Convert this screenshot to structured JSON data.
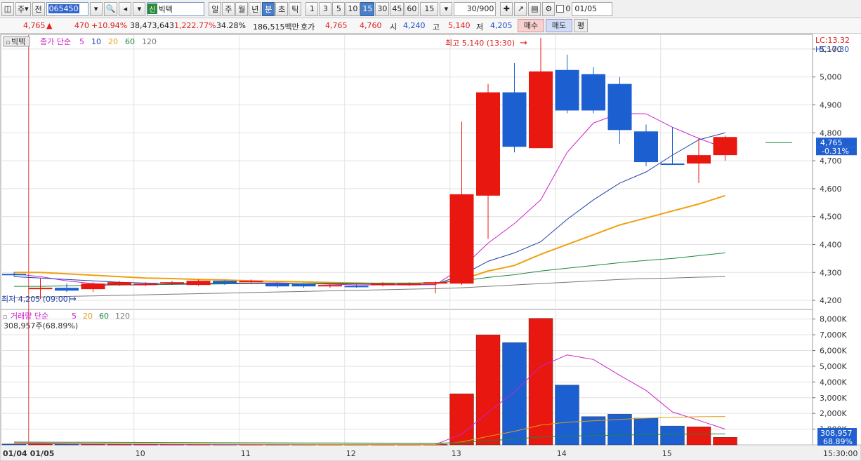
{
  "toolbar": {
    "period_unit_label": "주",
    "market_label": "전",
    "stock_code": "065450",
    "stock_tag": "신",
    "stock_name": "빅텍",
    "periods": [
      "일",
      "주",
      "월",
      "년",
      "분",
      "초",
      "틱"
    ],
    "selected_period": "분",
    "intervals": [
      "1",
      "3",
      "5",
      "10",
      "15",
      "30",
      "45",
      "60"
    ],
    "selected_interval": "15",
    "interval_value": "15",
    "count": "30/900",
    "date": "01/05",
    "checkbox_label": "0"
  },
  "info": {
    "price": "4,765",
    "change_arrow": "▲",
    "change": "470",
    "change_pct": "+10.94%",
    "volume": "38,473,643",
    "volume_pct": "1,222.77%",
    "turnover": "34.28%",
    "amount": "186,515백만",
    "ask_label": "호가",
    "ask": "4,765",
    "bid": "4,760",
    "open_label": "시",
    "open": "4,240",
    "high_label": "고",
    "high": "5,140",
    "low_label": "저",
    "low": "4,205",
    "buy_label": "매수",
    "sell_label": "매도",
    "avg_label": "평"
  },
  "price_panel": {
    "name_tag": "빅텍",
    "legend_prefix": "종가 단순",
    "ma_periods": [
      "5",
      "10",
      "20",
      "60",
      "120"
    ],
    "ma_colors": [
      "#cc22cc",
      "#1f3fa8",
      "#f0a010",
      "#1a8a3a",
      "#777777"
    ],
    "lc_label": "LC:13.32",
    "hc_label": "HC:-7.30",
    "high_annotation": "최고 5,140 (13:30)",
    "low_annotation": "최저 4,205 (09:00)",
    "current_price_label": "4,765",
    "current_pct_label": "-0.31%"
  },
  "volume_panel": {
    "legend_prefix": "거래량 단순",
    "ma_periods": [
      "5",
      "20",
      "60",
      "120"
    ],
    "ma_colors": [
      "#cc22cc",
      "#e0a010",
      "#1a8a3a",
      "#777777"
    ],
    "current_volume_label": "308,957주(68.89%)",
    "current_value_label": "308,957",
    "current_pct_label": "68.89%"
  },
  "x_axis": {
    "date_left": "01/04",
    "date_right": "01/05",
    "hour_labels": [
      "10",
      "11",
      "12",
      "13",
      "14",
      "15"
    ],
    "end_time": "15:30:00"
  },
  "colors": {
    "up": "#e8170f",
    "down": "#1b5fd0",
    "grid": "#e2e2e2"
  },
  "chart_data": [
    {
      "type": "candlestick",
      "title": "",
      "ylim": [
        4170,
        5150
      ],
      "y_ticks": [
        4200,
        4300,
        4400,
        4500,
        4600,
        4700,
        4800,
        4900,
        5000,
        5100
      ],
      "y_tick_labels": [
        "4,200",
        "4,300",
        "4,400",
        "4,500",
        "4,600",
        "4,700",
        "4,800",
        "4,900",
        "5,000",
        "5,100"
      ],
      "x": [
        "01/04 15:15",
        "09:00",
        "09:15",
        "09:30",
        "09:45",
        "10:00",
        "10:15",
        "10:30",
        "10:45",
        "11:00",
        "11:15",
        "11:30",
        "11:45",
        "12:00",
        "12:15",
        "12:30",
        "12:45",
        "13:00",
        "13:15",
        "13:30",
        "13:45",
        "14:00",
        "14:15",
        "14:30",
        "14:45",
        "15:00",
        "15:15",
        "15:30"
      ],
      "open": [
        4295,
        4240,
        4245,
        4240,
        4255,
        4255,
        4260,
        4255,
        4270,
        4265,
        4260,
        4258,
        4250,
        4252,
        4255,
        4258,
        4260,
        4260,
        4575,
        4945,
        4745,
        5025,
        5010,
        4975,
        4805,
        4690,
        4690,
        4720
      ],
      "close": [
        4290,
        4245,
        4235,
        4260,
        4265,
        4260,
        4265,
        4270,
        4260,
        4270,
        4250,
        4250,
        4255,
        4250,
        4260,
        4260,
        4265,
        4580,
        4945,
        4750,
        5020,
        4880,
        4880,
        4810,
        4695,
        4685,
        4720,
        4785
      ],
      "high": [
        4300,
        4280,
        4260,
        4265,
        4270,
        4265,
        4270,
        4275,
        4272,
        4275,
        4265,
        4262,
        4260,
        4258,
        4265,
        4265,
        4268,
        4840,
        4975,
        5050,
        5140,
        5080,
        5035,
        5000,
        4830,
        4820,
        4780,
        4790
      ],
      "low": [
        4285,
        4205,
        4230,
        4230,
        4252,
        4252,
        4255,
        4252,
        4255,
        4258,
        4245,
        4245,
        4245,
        4245,
        4250,
        4252,
        4225,
        4255,
        4420,
        4730,
        4745,
        4870,
        4870,
        4760,
        4680,
        4685,
        4620,
        4700
      ],
      "ma_series": [
        {
          "name": "5",
          "values": [
            4295,
            4285,
            4270,
            4260,
            4255,
            4255,
            4258,
            4260,
            4262,
            4262,
            4263,
            4260,
            4258,
            4255,
            4255,
            4255,
            4256,
            4315,
            4405,
            4475,
            4560,
            4730,
            4835,
            4870,
            4868,
            4820,
            4780,
            4745
          ]
        },
        {
          "name": "10",
          "values": [
            4285,
            4280,
            4275,
            4270,
            4265,
            4262,
            4260,
            4260,
            4260,
            4260,
            4260,
            4260,
            4259,
            4259,
            4258,
            4258,
            4258,
            4290,
            4340,
            4370,
            4410,
            4490,
            4560,
            4620,
            4660,
            4720,
            4775,
            4800
          ]
        },
        {
          "name": "20",
          "values": [
            4300,
            4300,
            4295,
            4290,
            4285,
            4280,
            4278,
            4275,
            4273,
            4270,
            4268,
            4266,
            4264,
            4262,
            4260,
            4260,
            4260,
            4275,
            4305,
            4325,
            4365,
            4400,
            4435,
            4470,
            4495,
            4520,
            4545,
            4575
          ]
        },
        {
          "name": "60",
          "values": [
            4250,
            4250,
            4252,
            4254,
            4255,
            4256,
            4257,
            4258,
            4259,
            4260,
            4260,
            4260,
            4261,
            4261,
            4262,
            4262,
            4263,
            4270,
            4282,
            4292,
            4305,
            4315,
            4325,
            4335,
            4343,
            4350,
            4360,
            4370
          ]
        },
        {
          "name": "120",
          "values": [
            4210,
            4212,
            4214,
            4216,
            4218,
            4220,
            4222,
            4224,
            4226,
            4228,
            4230,
            4232,
            4234,
            4236,
            4238,
            4240,
            4242,
            4245,
            4250,
            4255,
            4260,
            4265,
            4270,
            4275,
            4278,
            4280,
            4283,
            4285
          ]
        }
      ]
    },
    {
      "type": "bar",
      "title": "",
      "ylim": [
        0,
        8300
      ],
      "y_ticks": [
        1000,
        2000,
        3000,
        4000,
        5000,
        6000,
        7000,
        8000
      ],
      "y_tick_labels": [
        "1,000K",
        "2,000K",
        "3,000K",
        "4,000K",
        "5,000K",
        "6,000K",
        "7,000K",
        "8,000K"
      ],
      "y_unit": "K",
      "values": [
        60,
        120,
        40,
        40,
        30,
        30,
        30,
        30,
        30,
        30,
        30,
        30,
        30,
        30,
        30,
        30,
        30,
        3250,
        7000,
        6500,
        8050,
        3800,
        1800,
        1950,
        1700,
        1200,
        1150,
        480
      ],
      "ma_series": [
        {
          "name": "5",
          "values": [
            60,
            70,
            60,
            55,
            50,
            45,
            35,
            32,
            30,
            30,
            30,
            30,
            30,
            30,
            30,
            30,
            30,
            680,
            2075,
            3370,
            4990,
            5720,
            5430,
            4420,
            3460,
            2090,
            1560,
            1000
          ]
        },
        {
          "name": "20",
          "values": [
            130,
            120,
            100,
            90,
            80,
            70,
            60,
            55,
            50,
            45,
            40,
            35,
            30,
            30,
            30,
            30,
            30,
            190,
            540,
            860,
            1260,
            1440,
            1530,
            1620,
            1700,
            1750,
            1790,
            1800
          ]
        },
        {
          "name": "60",
          "values": [
            180,
            175,
            170,
            165,
            160,
            155,
            150,
            145,
            140,
            135,
            130,
            125,
            120,
            115,
            110,
            105,
            100,
            150,
            260,
            370,
            500,
            560,
            590,
            620,
            650,
            670,
            690,
            700
          ]
        }
      ]
    }
  ]
}
